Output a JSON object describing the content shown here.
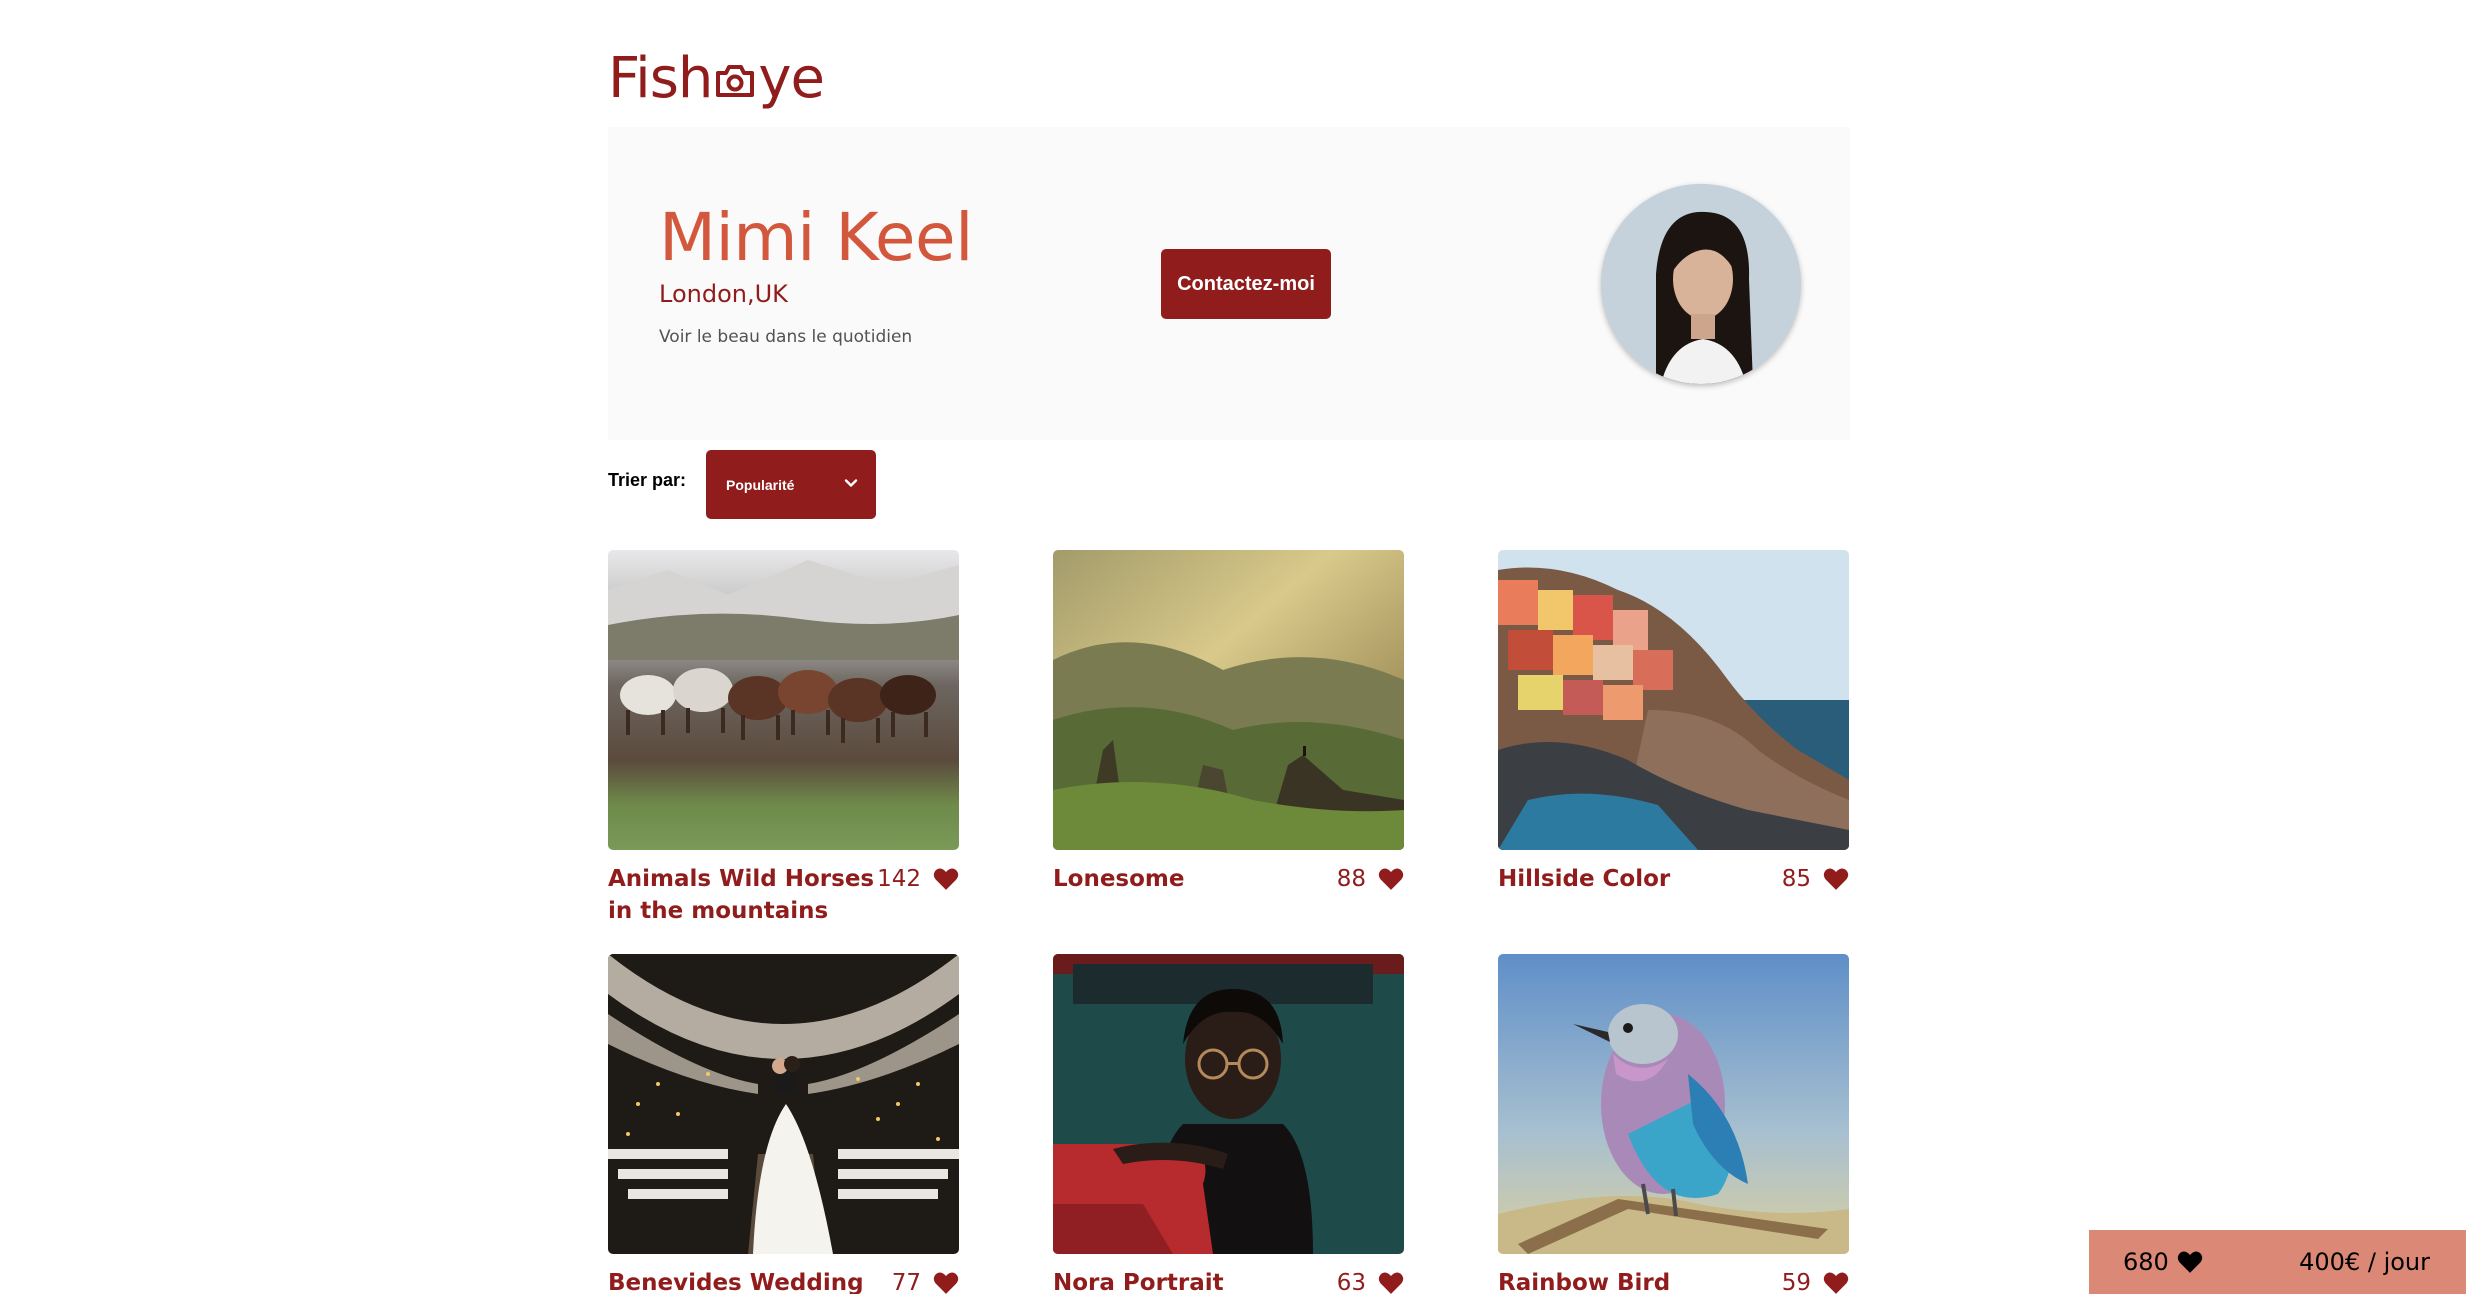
{
  "logo": {
    "text_before": "Fish",
    "text_after": "ye",
    "icon": "camera-icon"
  },
  "photographer": {
    "name": "Mimi Keel",
    "location": "London,UK",
    "tagline": "Voir le beau dans le quotidien"
  },
  "contact_button": {
    "label": "Contactez-moi"
  },
  "sort": {
    "label": "Trier par:",
    "selected": "Popularité"
  },
  "media": [
    {
      "title": "Animals Wild Horses in the mountains",
      "likes": "142"
    },
    {
      "title": "Lonesome",
      "likes": "88"
    },
    {
      "title": "Hillside Color",
      "likes": "85"
    },
    {
      "title": "Benevides Wedding",
      "likes": "77"
    },
    {
      "title": "Nora Portrait",
      "likes": "63"
    },
    {
      "title": "Rainbow Bird",
      "likes": "59"
    }
  ],
  "summary": {
    "total_likes": "680",
    "price": "400€ / jour"
  },
  "colors": {
    "brand": "#901c1c",
    "accent": "#d3573c",
    "counter_bg": "#db8876",
    "header_bg": "#fafafa"
  }
}
